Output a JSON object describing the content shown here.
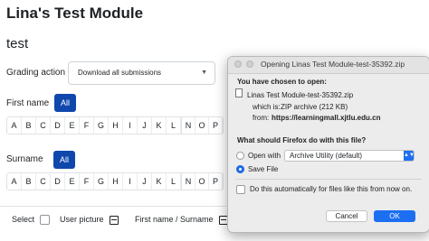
{
  "page": {
    "title": "Lina's Test Module",
    "subtitle": "test"
  },
  "grading": {
    "label": "Grading action",
    "selected": "Download all submissions"
  },
  "firstname": {
    "label": "First name",
    "all_label": "All",
    "letters_left": [
      "A",
      "B",
      "C",
      "D",
      "E",
      "F",
      "G",
      "H",
      "I",
      "J",
      "K",
      "L",
      "M"
    ],
    "letters_right": [
      "N",
      "O",
      "P"
    ]
  },
  "surname": {
    "label": "Surname",
    "all_label": "All",
    "letters_left": [
      "A",
      "B",
      "C",
      "D",
      "E",
      "F",
      "G",
      "H",
      "I",
      "J",
      "K",
      "L",
      "M"
    ],
    "letters_right": [
      "N",
      "O",
      "P"
    ]
  },
  "table": {
    "select_label": "Select",
    "user_picture_label": "User picture",
    "name_label": "First name / Surname"
  },
  "dialog": {
    "title": "Opening Linas Test Module-test-35392.zip",
    "chosen_heading": "You have chosen to open:",
    "filename": "Linas Test Module-test-35392.zip",
    "which_is_label": "which is:",
    "which_is_value": "ZIP archive (212 KB)",
    "from_label": "from:",
    "from_value": "https://learningmall.xjtlu.edu.cn",
    "question": "What should Firefox do with this file?",
    "open_with_label": "Open with",
    "open_with_app": "Archive Utility (default)",
    "save_file_label": "Save File",
    "auto_label": "Do this automatically for files like this from now on.",
    "cancel_label": "Cancel",
    "ok_label": "OK",
    "selected_option": "save_file"
  },
  "colors": {
    "primary": "#0f47ad",
    "mac_accent": "#1d6ff2"
  }
}
